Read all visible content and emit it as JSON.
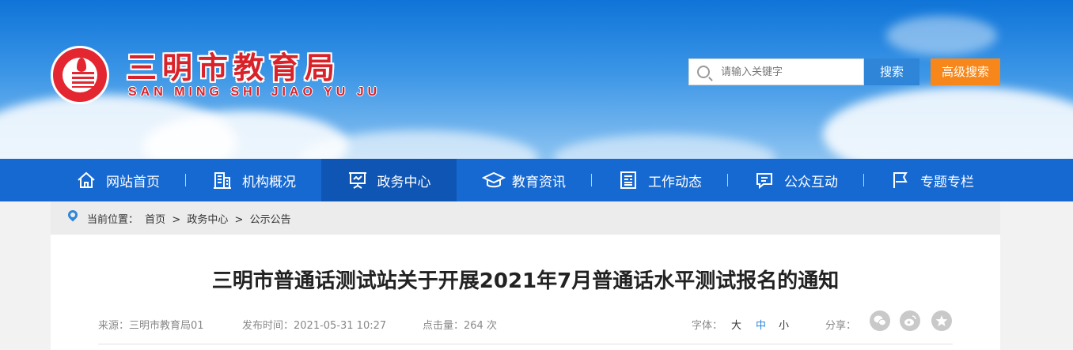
{
  "header": {
    "title": "三明市教育局",
    "subtitle": "SAN MING SHI JIAO YU JU",
    "search_placeholder": "请输入关键字",
    "search_button": "搜索",
    "advanced_search_button": "高级搜索"
  },
  "nav": {
    "items": [
      {
        "label": "网站首页",
        "icon": "home-icon"
      },
      {
        "label": "机构概况",
        "icon": "building-icon"
      },
      {
        "label": "政务中心",
        "icon": "presentation-icon",
        "active": true
      },
      {
        "label": "教育资讯",
        "icon": "graduation-cap-icon"
      },
      {
        "label": "工作动态",
        "icon": "newspaper-icon"
      },
      {
        "label": "公众互动",
        "icon": "chat-icon"
      },
      {
        "label": "专题专栏",
        "icon": "flag-icon"
      }
    ]
  },
  "breadcrumb": {
    "prefix": "当前位置：",
    "items": [
      "首页",
      ">",
      "政务中心",
      ">",
      "公示公告"
    ]
  },
  "article": {
    "title": "三明市普通话测试站关于开展2021年7月普通话水平测试报名的通知",
    "source": "来源：三明市教育局01",
    "published": "发布时间：2021-05-31 10:27",
    "views": "点击量：264 次",
    "font_label": "字体：",
    "font_sizes": [
      "大",
      "中",
      "小"
    ],
    "share_label": "分享：",
    "share_icons": [
      "wechat-icon",
      "weibo-icon",
      "favorite-star-icon"
    ]
  },
  "colors": {
    "nav_bg": "#1769d2",
    "nav_active": "#0f55b4",
    "search_btn": "#2f86d9",
    "advanced_btn": "#f7871a",
    "logo_red": "#d8232a"
  }
}
